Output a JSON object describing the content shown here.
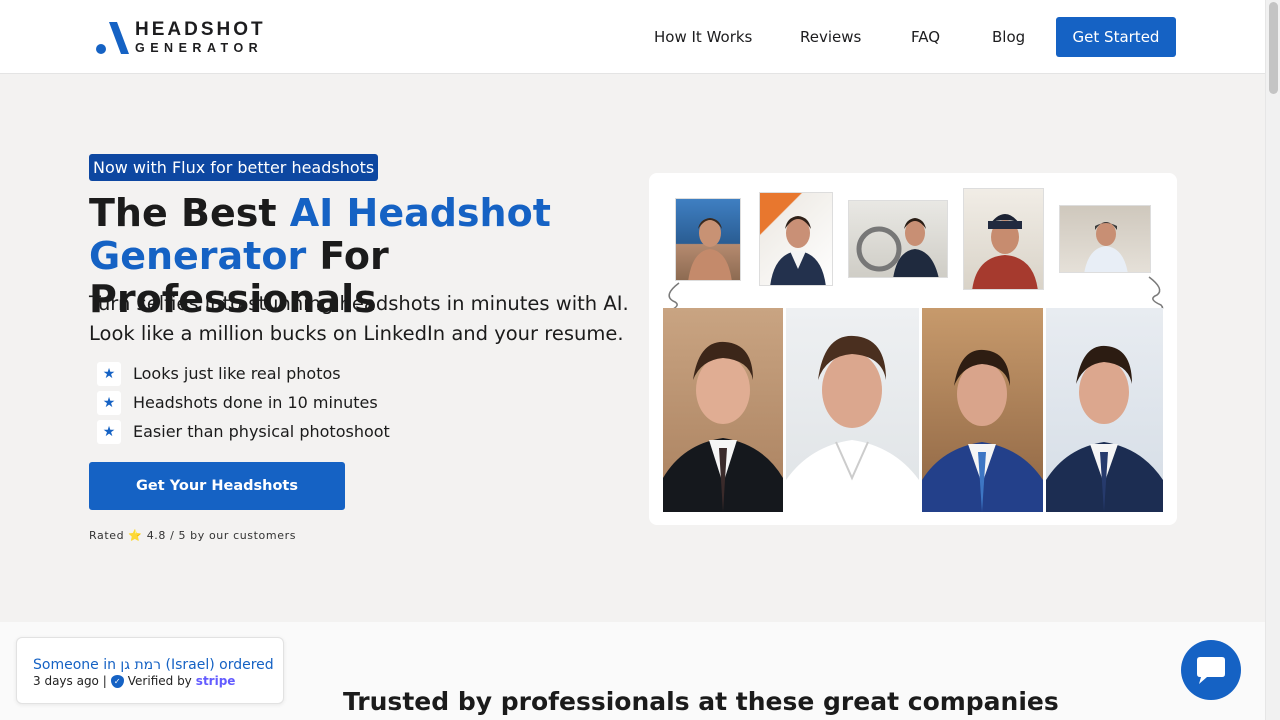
{
  "header": {
    "logo": {
      "line1": "HEADSHOT",
      "line2": "GENERATOR"
    },
    "nav": [
      {
        "label": "How It Works"
      },
      {
        "label": "Reviews"
      },
      {
        "label": "FAQ"
      },
      {
        "label": "Blog"
      }
    ],
    "cta_label": "Get Started"
  },
  "hero": {
    "badge": "Now with Flux for better headshots",
    "title_part1": "The Best ",
    "title_accent": "AI Headshot Generator",
    "title_part2": " For Professionals",
    "subtitle": "Turn selfies into stunning headshots in minutes with AI. Look like a million bucks on LinkedIn and your resume.",
    "features": [
      {
        "icon": "star-icon",
        "label": "Looks just like real photos"
      },
      {
        "icon": "star-icon",
        "label": "Headshots done in 10 minutes"
      },
      {
        "icon": "star-icon",
        "label": "Easier than physical photoshoot"
      }
    ],
    "cta_label": "Get Your Headshots",
    "rating_text": "Rated ⭐ 4.8 / 5 by our customers"
  },
  "trusted": {
    "heading": "Trusted by professionals at these great companies"
  },
  "toast": {
    "title": "Someone in רמת גן (Israel) ordered",
    "time": "3 days ago |",
    "verified": "Verified by",
    "brand": "stripe"
  },
  "colors": {
    "accent": "#1562c4",
    "badge_bg": "#0d47a1",
    "page_bg": "#f3f2f1"
  }
}
